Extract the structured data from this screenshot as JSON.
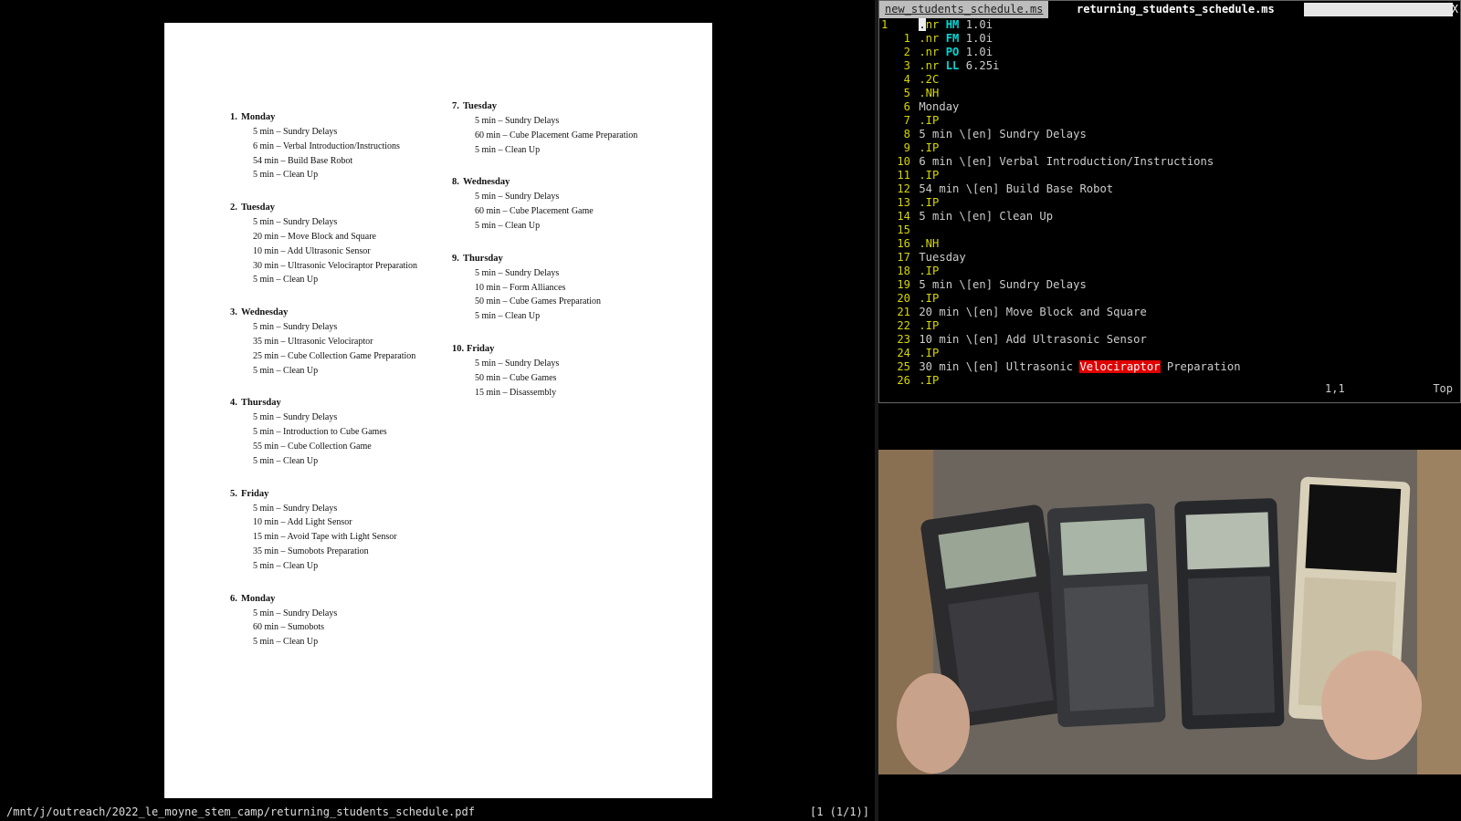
{
  "pdf": {
    "path": "/mnt/j/outreach/2022_le_moyne_stem_camp/returning_students_schedule.pdf",
    "page_indicator": "[1 (1/1)]",
    "days": [
      {
        "num": "1.",
        "name": "Monday",
        "items": [
          "5 min – Sundry Delays",
          "6 min – Verbal Introduction/Instructions",
          "54 min – Build Base Robot",
          "5 min – Clean Up"
        ]
      },
      {
        "num": "2.",
        "name": "Tuesday",
        "items": [
          "5 min – Sundry Delays",
          "20 min – Move Block and Square",
          "10 min – Add Ultrasonic Sensor",
          "30 min – Ultrasonic Velociraptor Preparation",
          "5 min – Clean Up"
        ]
      },
      {
        "num": "3.",
        "name": "Wednesday",
        "items": [
          "5 min – Sundry Delays",
          "35 min – Ultrasonic Velociraptor",
          "25 min – Cube Collection Game Preparation",
          "5 min – Clean Up"
        ]
      },
      {
        "num": "4.",
        "name": "Thursday",
        "items": [
          "5 min – Sundry Delays",
          "5 min – Introduction to Cube Games",
          "55 min – Cube Collection Game",
          "5 min – Clean Up"
        ]
      },
      {
        "num": "5.",
        "name": "Friday",
        "items": [
          "5 min – Sundry Delays",
          "10 min – Add Light Sensor",
          "15 min – Avoid Tape with Light Sensor",
          "35 min – Sumobots Preparation",
          "5 min – Clean Up"
        ]
      },
      {
        "num": "6.",
        "name": "Monday",
        "items": [
          "5 min – Sundry Delays",
          "60 min – Sumobots",
          "5 min – Clean Up"
        ]
      },
      {
        "num": "7.",
        "name": "Tuesday",
        "items": [
          "5 min – Sundry Delays",
          "60 min – Cube Placement Game Preparation",
          "5 min – Clean Up"
        ]
      },
      {
        "num": "8.",
        "name": "Wednesday",
        "items": [
          "5 min – Sundry Delays",
          "60 min – Cube Placement Game",
          "5 min – Clean Up"
        ]
      },
      {
        "num": "9.",
        "name": "Thursday",
        "items": [
          "5 min – Sundry Delays",
          "10 min – Form Alliances",
          "50 min – Cube Games Preparation",
          "5 min – Clean Up"
        ]
      },
      {
        "num": "10.",
        "name": "Friday",
        "items": [
          "5 min – Sundry Delays",
          "50 min – Cube Games",
          "15 min – Disassembly"
        ]
      }
    ]
  },
  "vim": {
    "tabs": {
      "inactive": "new_students_schedule.ms",
      "active": "returning_students_schedule.ms",
      "close": "X"
    },
    "lines": [
      {
        "no": "1",
        "req": ".nr",
        "reg": "HM",
        "val": "1.0i",
        "cursor": true
      },
      {
        "no": "1",
        "req": ".nr",
        "reg": "FM",
        "val": "1.0i"
      },
      {
        "no": "2",
        "req": ".nr",
        "reg": "PO",
        "val": "1.0i"
      },
      {
        "no": "3",
        "req": ".nr",
        "reg": "LL",
        "val": "6.25i"
      },
      {
        "no": "4",
        "req": ".2C"
      },
      {
        "no": "5",
        "req": ".NH"
      },
      {
        "no": "6",
        "text": "Monday"
      },
      {
        "no": "7",
        "req": ".IP"
      },
      {
        "no": "8",
        "text": "5 min \\[en] Sundry Delays"
      },
      {
        "no": "9",
        "req": ".IP"
      },
      {
        "no": "10",
        "text": "6 min \\[en] Verbal Introduction/Instructions"
      },
      {
        "no": "11",
        "req": ".IP"
      },
      {
        "no": "12",
        "text": "54 min \\[en] Build Base Robot"
      },
      {
        "no": "13",
        "req": ".IP"
      },
      {
        "no": "14",
        "text": "5 min \\[en] Clean Up"
      },
      {
        "no": "15"
      },
      {
        "no": "16",
        "req": ".NH"
      },
      {
        "no": "17",
        "text": "Tuesday"
      },
      {
        "no": "18",
        "req": ".IP"
      },
      {
        "no": "19",
        "text": "5 min \\[en] Sundry Delays"
      },
      {
        "no": "20",
        "req": ".IP"
      },
      {
        "no": "21",
        "text": "20 min \\[en] Move Block and Square"
      },
      {
        "no": "22",
        "req": ".IP"
      },
      {
        "no": "23",
        "text": "10 min \\[en] Add Ultrasonic Sensor"
      },
      {
        "no": "24",
        "req": ".IP"
      },
      {
        "no": "25",
        "text": "30 min \\[en] Ultrasonic ",
        "hl": "Velociraptor",
        "after": " Preparation"
      },
      {
        "no": "26",
        "req": ".IP"
      }
    ],
    "status": {
      "position": "1,1",
      "scroll": "Top"
    }
  },
  "colors": {
    "line_number": "#d7d700",
    "register": "#00d7d7",
    "search_highlight": "#e00000"
  }
}
